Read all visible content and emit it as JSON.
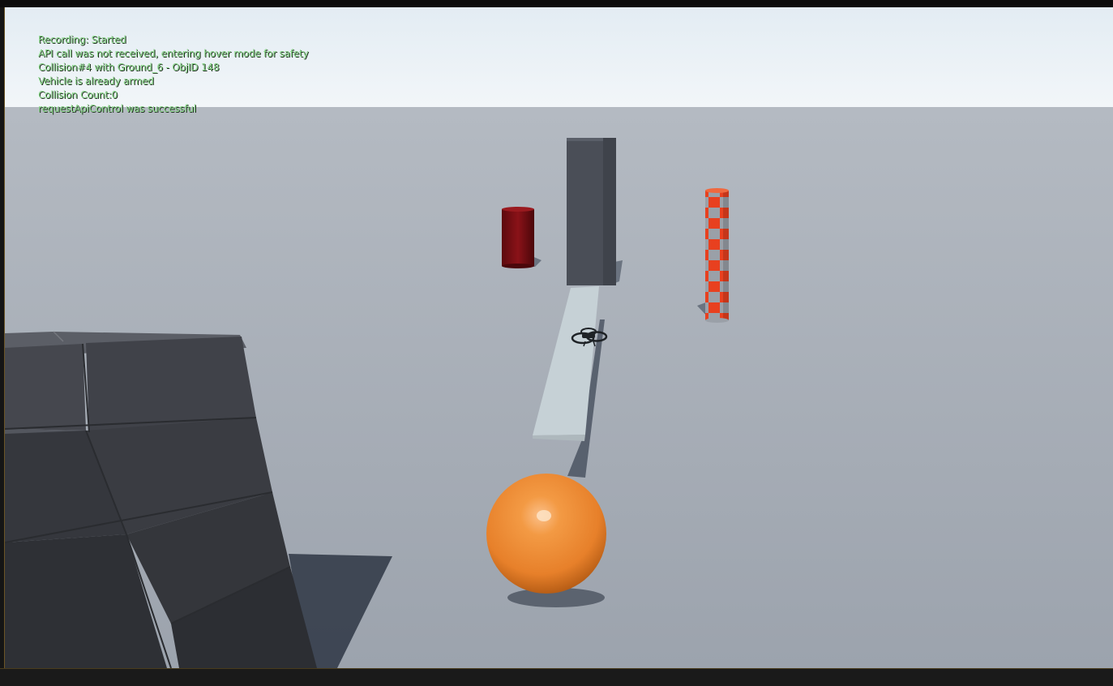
{
  "hud": {
    "messages": [
      "Recording: Started",
      "API call was not received, entering hover mode for safety",
      "Collision#4 with Ground_6 - ObjID 148",
      "Vehicle is already armed",
      "Collision Count:0",
      "requestApiControl was successful"
    ],
    "text_color": "#8bd88b"
  },
  "scene": {
    "objects": [
      "sky",
      "ground-plane",
      "stacked-cube-blocks",
      "dark-red-cylinder",
      "gray-tall-box",
      "red-checkered-pillar",
      "light-ramp",
      "quadcopter-drone",
      "orange-sphere"
    ],
    "colors": {
      "sky": "#e6eef4",
      "ground": "#a4abb5",
      "blocks": "#3f4148",
      "red_cylinder": "#7a0d12",
      "gray_box": "#4a4e57",
      "checker_red": "#e8401f",
      "checker_gray": "#9aa0a8",
      "ramp": "#c6d1d6",
      "sphere": "#ef8b2c"
    }
  }
}
